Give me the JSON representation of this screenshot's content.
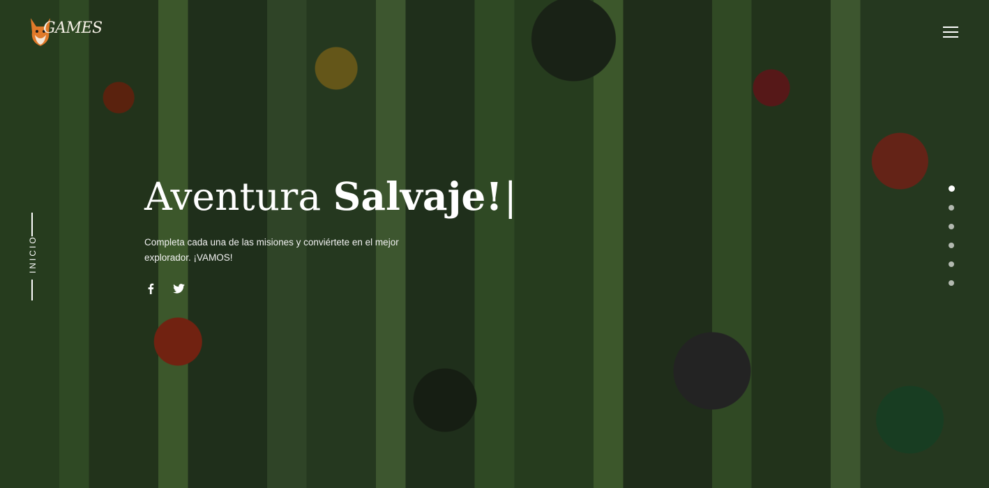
{
  "brand": {
    "logo_text": "GAMES",
    "accent_color": "#e07a2a"
  },
  "header": {
    "menu_icon": "hamburger-menu-icon"
  },
  "side": {
    "section_label": "INICIO"
  },
  "hero": {
    "title_light": "Aventura ",
    "title_bold": "Salvaje!",
    "cursor": "|",
    "subtitle": "Completa cada una de las misiones y conviértete en el mejor explorador. ¡VAMOS!",
    "socials": [
      {
        "icon": "facebook-icon"
      },
      {
        "icon": "twitter-icon"
      }
    ]
  },
  "pagination": {
    "total": 6,
    "active_index": 0
  }
}
